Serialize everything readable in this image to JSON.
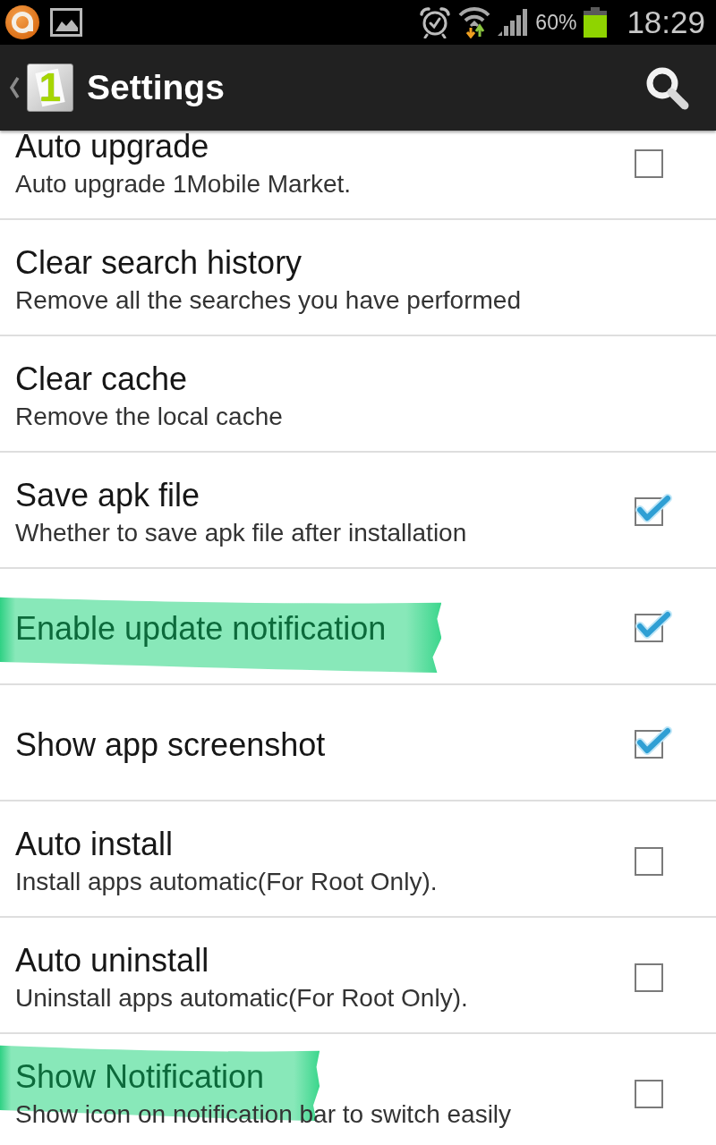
{
  "status_bar": {
    "battery_percent": "60%",
    "time": "18:29"
  },
  "action_bar": {
    "app_icon_text": "1",
    "title": "Settings"
  },
  "settings": [
    {
      "kind": "checkbox",
      "title": "Auto upgrade",
      "summary": "Auto upgrade 1Mobile Market.",
      "checked": false,
      "highlighted": false
    },
    {
      "kind": "action",
      "title": "Clear search history",
      "summary": "Remove all the searches you have performed",
      "highlighted": false
    },
    {
      "kind": "action",
      "title": "Clear cache",
      "summary": "Remove the local cache",
      "highlighted": false
    },
    {
      "kind": "checkbox",
      "title": "Save apk file",
      "summary": "Whether to save apk file after installation",
      "checked": true,
      "highlighted": false
    },
    {
      "kind": "checkbox",
      "title": "Enable update notification",
      "checked": true,
      "highlighted": true
    },
    {
      "kind": "checkbox",
      "title": "Show app screenshot",
      "checked": true,
      "highlighted": false
    },
    {
      "kind": "checkbox",
      "title": "Auto install",
      "summary": "Install apps automatic(For Root Only).",
      "checked": false,
      "highlighted": false
    },
    {
      "kind": "checkbox",
      "title": "Auto uninstall",
      "summary": "Uninstall apps automatic(For Root Only).",
      "checked": false,
      "highlighted": false
    },
    {
      "kind": "checkbox",
      "title": "Show Notification",
      "summary": "Show icon on notification bar to switch easily",
      "checked": false,
      "highlighted": true
    }
  ]
}
